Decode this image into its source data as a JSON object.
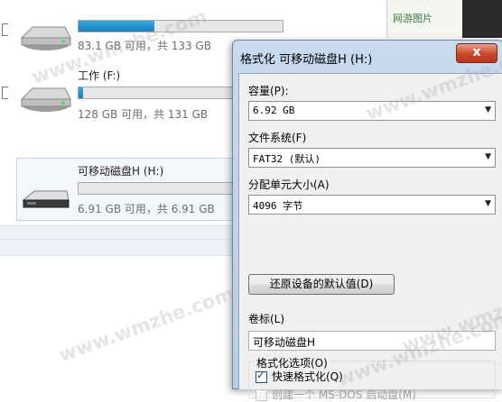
{
  "explorer": {
    "drives": [
      {
        "name": "",
        "space": "83.1 GB 可用，共 133 GB",
        "used_fraction": 0.37
      },
      {
        "name": "工作 (F:)",
        "space": "128 GB 可用，共 131 GB",
        "used_fraction": 0.02
      },
      {
        "name": "可移动磁盘H (H:)",
        "space": "6.91 GB 可用，共 6.91 GB",
        "used_fraction": 0.0
      }
    ]
  },
  "background_window": {
    "thumb_text": "网游图片"
  },
  "dialog": {
    "title": "格式化 可移动磁盘H (H:)",
    "close_glyph": "x",
    "capacity": {
      "label": "容量(P):",
      "value": "6.92 GB"
    },
    "filesystem": {
      "label": "文件系统(F)",
      "value": "FAT32 (默认)"
    },
    "allocation": {
      "label": "分配单元大小(A)",
      "value": "4096 字节"
    },
    "restore_button": "还原设备的默认值(D)",
    "volume": {
      "label": "卷标(L)",
      "value": "可移动磁盘H"
    },
    "options": {
      "legend": "格式化选项(O)",
      "quick_format": {
        "label": "快速格式化(Q)",
        "checked": true
      },
      "msdos_disk": {
        "label": "创建一个 MS-DOS 启动盘(M)",
        "checked": false,
        "disabled": true
      }
    }
  },
  "watermarks": [
    "www.wmzhe.com",
    "www.wmzhe.com",
    "www.wmzhe.com",
    "www.wmzhe.com",
    "www.wmzhe.com"
  ],
  "colors": {
    "accent": "#1b7fc2",
    "close": "#c8462a",
    "title_bar": "#c8daee"
  }
}
